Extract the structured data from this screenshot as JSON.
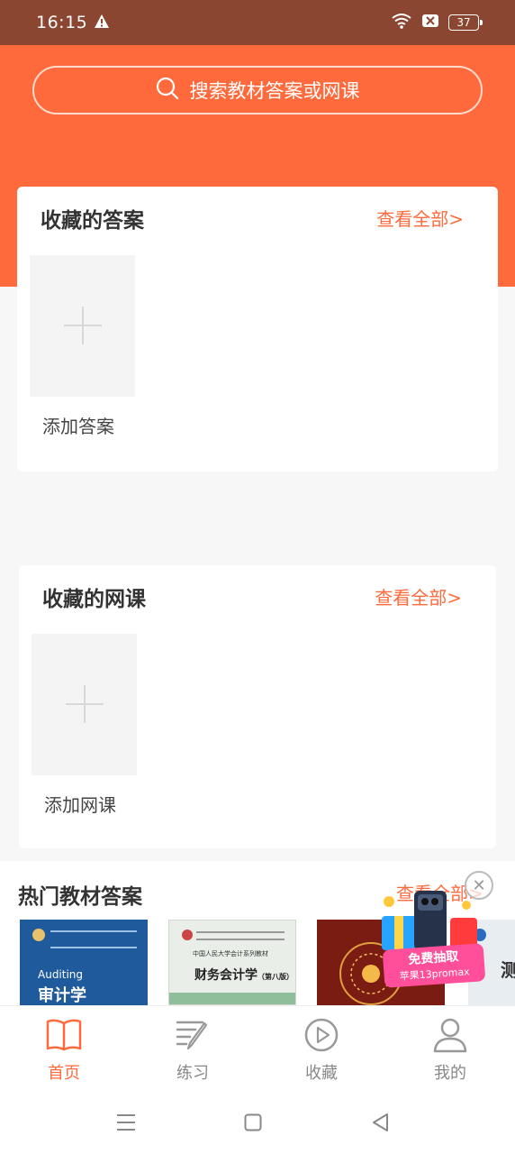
{
  "status_bar": {
    "time": "16:15",
    "battery": "37"
  },
  "search": {
    "placeholder": "搜索教材答案或网课"
  },
  "favorites_answers": {
    "title": "收藏的答案",
    "more": "查看全部>",
    "add_label": "添加答案"
  },
  "favorites_courses": {
    "title": "收藏的网课",
    "more": "查看全部>",
    "add_label": "添加网课"
  },
  "hot_textbooks": {
    "title": "热门教材答案",
    "more": "查看全部>",
    "books": [
      {
        "en": "Auditing",
        "title": "审计学"
      },
      {
        "series": "中国人民大学会计系列教材",
        "title": "财务会计学",
        "edition": "（第八版）"
      },
      {
        "title": ""
      },
      {
        "title": "测"
      }
    ]
  },
  "promo": {
    "line1": "免费抽取",
    "line2": "苹果13promax"
  },
  "tabs": [
    {
      "label": "首页",
      "icon": "book-icon"
    },
    {
      "label": "练习",
      "icon": "pen-icon"
    },
    {
      "label": "收藏",
      "icon": "play-circle-icon"
    },
    {
      "label": "我的",
      "icon": "user-icon"
    }
  ],
  "colors": {
    "accent": "#ff6a3c",
    "status_bar": "#8a4630"
  }
}
